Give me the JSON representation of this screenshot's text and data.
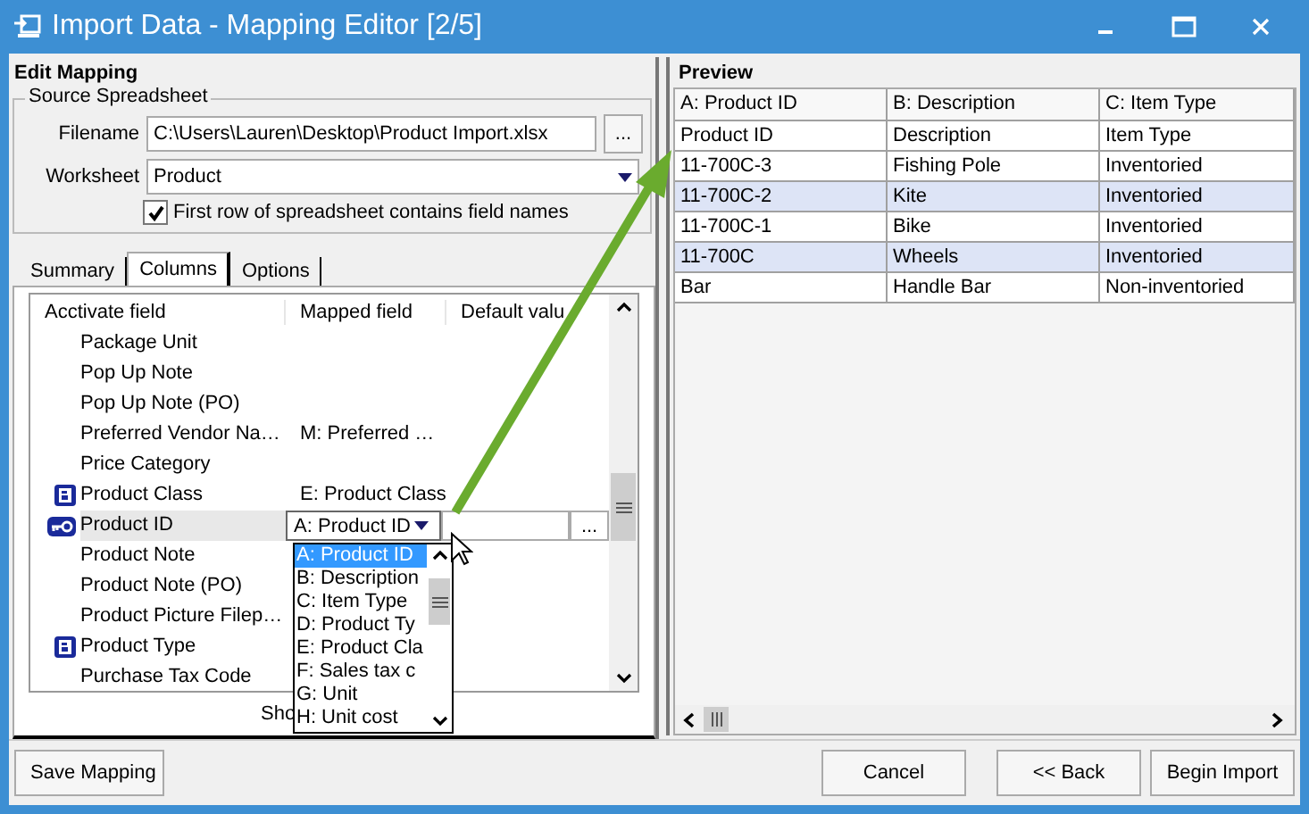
{
  "window": {
    "title": "Import Data - Mapping Editor [2/5]"
  },
  "edit_mapping": {
    "title": "Edit Mapping",
    "group_title": "Source Spreadsheet",
    "filename_label": "Filename",
    "filename": "C:\\Users\\Lauren\\Desktop\\Product Import.xlsx",
    "browse": "...",
    "worksheet_label": "Worksheet",
    "worksheet": "Product",
    "first_row": {
      "label": "First row of spreadsheet contains field names",
      "checked": true
    }
  },
  "tabs": [
    {
      "label": "Summary",
      "selected": false
    },
    {
      "label": "Columns",
      "selected": true
    },
    {
      "label": "Options",
      "selected": false
    }
  ],
  "columns_grid": {
    "columns": [
      "Acctivate field",
      "Mapped field",
      "Default valu"
    ],
    "rows": [
      {
        "field": "Package Unit",
        "kind": "plain",
        "selected": false
      },
      {
        "field": "Pop Up Note",
        "kind": "plain",
        "selected": false
      },
      {
        "field": "Pop Up Note (PO)",
        "kind": "plain",
        "selected": false
      },
      {
        "field": "Preferred Vendor Na…",
        "kind": "plain",
        "mapped": "M: Preferred …",
        "selected": false
      },
      {
        "field": "Price Category",
        "kind": "plain",
        "selected": false
      },
      {
        "field": "Product Class",
        "kind": "required",
        "mapped": "E: Product Class",
        "selected": false
      },
      {
        "field": "Product ID",
        "kind": "key",
        "mapped": "A: Product ID",
        "selected": true,
        "browse": "..."
      },
      {
        "field": "Product Note",
        "kind": "plain",
        "selected": false
      },
      {
        "field": "Product Note (PO)",
        "kind": "plain",
        "selected": false
      },
      {
        "field": "Product Picture Filep…",
        "kind": "plain",
        "selected": false
      },
      {
        "field": "Product Type",
        "kind": "required",
        "selected": false
      },
      {
        "field": "Purchase Tax Code",
        "kind": "plain",
        "selected": false
      }
    ],
    "footer": "Sho"
  },
  "dropdown": [
    {
      "label": "A: Product ID",
      "selected": true
    },
    {
      "label": "B: Description",
      "selected": false
    },
    {
      "label": "C: Item Type",
      "selected": false
    },
    {
      "label": "D: Product Ty",
      "selected": false
    },
    {
      "label": "E: Product Cla",
      "selected": false
    },
    {
      "label": "F: Sales tax c",
      "selected": false
    },
    {
      "label": "G: Unit",
      "selected": false
    },
    {
      "label": "H: Unit cost",
      "selected": false
    }
  ],
  "preview": {
    "title": "Preview",
    "columns": [
      "A: Product ID",
      "B: Description",
      "C: Item Type"
    ],
    "rows": [
      {
        "cells": [
          "Product ID",
          "Description",
          "Item Type"
        ],
        "highlighted": false
      },
      {
        "cells": [
          "11-700C-3",
          "Fishing Pole",
          "Inventoried"
        ],
        "highlighted": false
      },
      {
        "cells": [
          "11-700C-2",
          "Kite",
          "Inventoried"
        ],
        "highlighted": true
      },
      {
        "cells": [
          "11-700C-1",
          "Bike",
          "Inventoried"
        ],
        "highlighted": false
      },
      {
        "cells": [
          "11-700C",
          "Wheels",
          "Inventoried"
        ],
        "highlighted": true
      },
      {
        "cells": [
          "Bar",
          "Handle Bar",
          "Non-inventoried"
        ],
        "highlighted": false
      }
    ]
  },
  "buttons": {
    "save": "Save Mapping",
    "cancel": "Cancel",
    "back": "<< Back",
    "begin": "Begin Import"
  }
}
